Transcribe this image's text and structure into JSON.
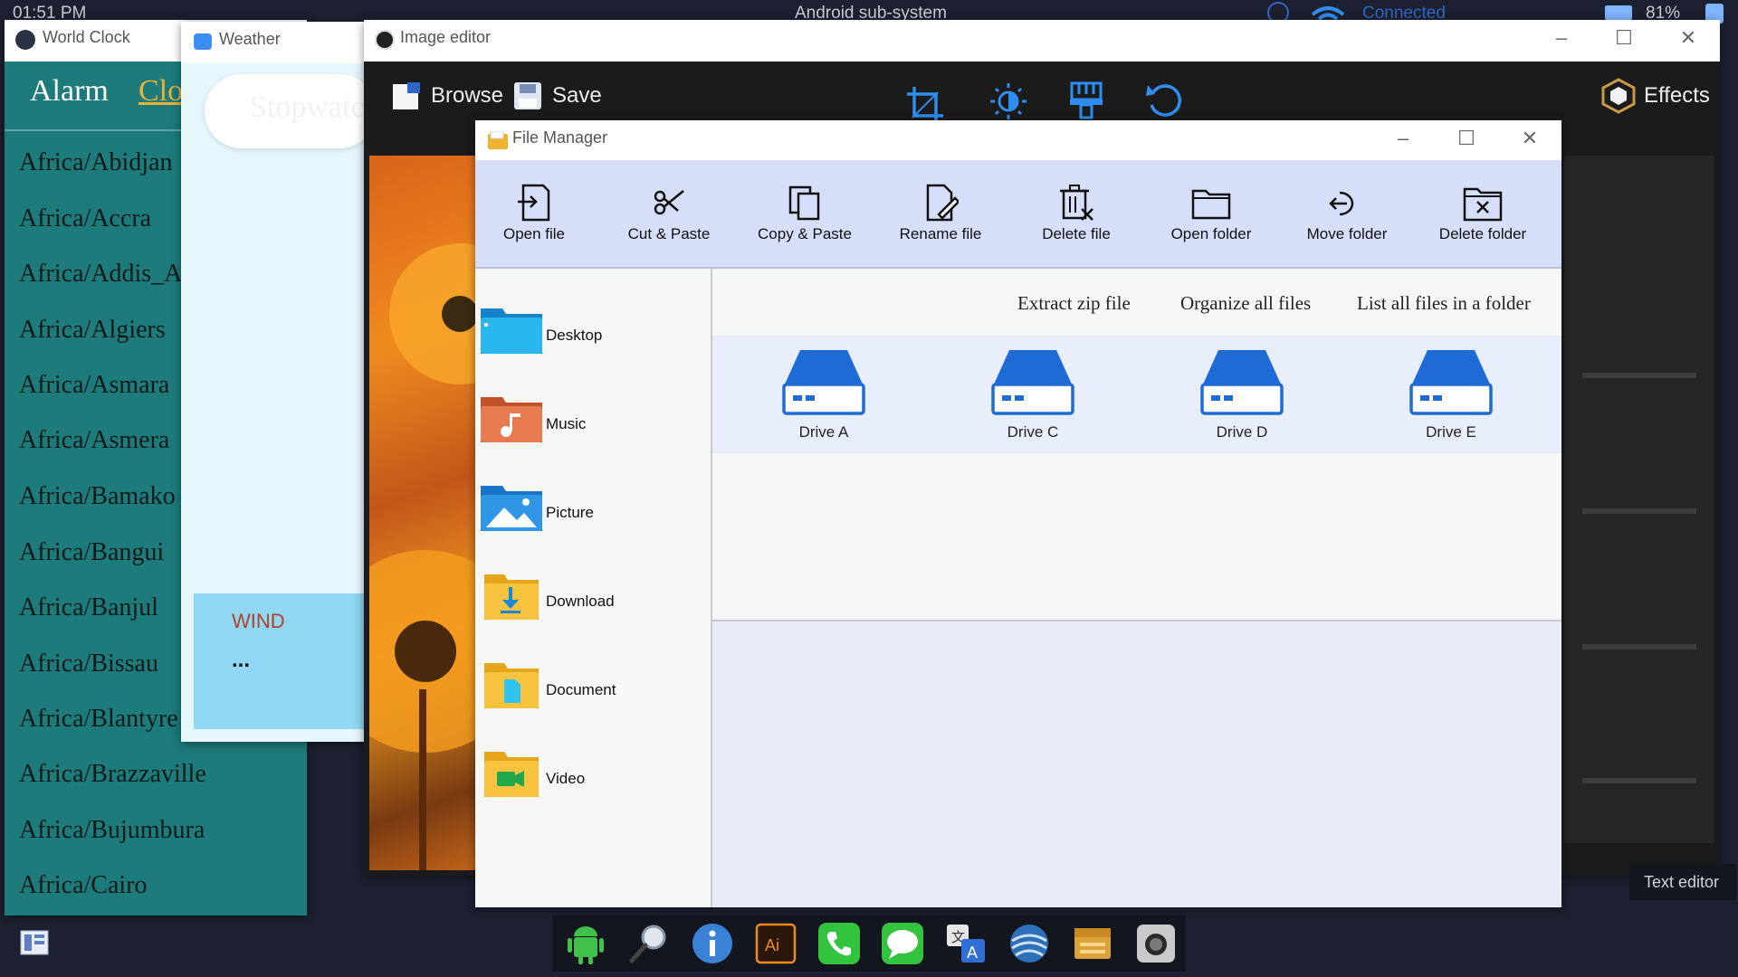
{
  "status_bar": {
    "time": "01:51 PM",
    "title": "Android sub-system",
    "wifi": "Connected",
    "battery": "81%"
  },
  "world_clock": {
    "title": "World Clock",
    "tabs": [
      "Alarm",
      "Clock"
    ],
    "cities": [
      "Africa/Abidjan",
      "Africa/Accra",
      "Africa/Addis_Ababa",
      "Africa/Algiers",
      "Africa/Asmara",
      "Africa/Asmera",
      "Africa/Bamako",
      "Africa/Bangui",
      "Africa/Banjul",
      "Africa/Bissau",
      "Africa/Blantyre",
      "Africa/Brazzaville",
      "Africa/Bujumbura",
      "Africa/Cairo"
    ]
  },
  "weather": {
    "title": "Weather",
    "stopwatch": "Stopwatch",
    "wind_label": "WIND",
    "wind_value": "..."
  },
  "image_editor": {
    "title": "Image editor",
    "browse": "Browse",
    "save": "Save",
    "effects": "Effects"
  },
  "file_manager": {
    "title": "File Manager",
    "toolbar": [
      "Open file",
      "Cut & Paste",
      "Copy & Paste",
      "Rename file",
      "Delete file",
      "Open folder",
      "Move folder",
      "Delete folder"
    ],
    "sidebar": [
      "Desktop",
      "Music",
      "Picture",
      "Download",
      "Document",
      "Video"
    ],
    "actions": [
      "Extract zip file",
      "Organize all files",
      "List all files in a folder"
    ],
    "drives": [
      "Drive A",
      "Drive C",
      "Drive D",
      "Drive E"
    ]
  },
  "text_editor_label": "Text editor",
  "colors": {
    "accent": "#1d7b7c",
    "fm_bg": "#e9ebf9",
    "drive_blue": "#1e6bd6"
  }
}
